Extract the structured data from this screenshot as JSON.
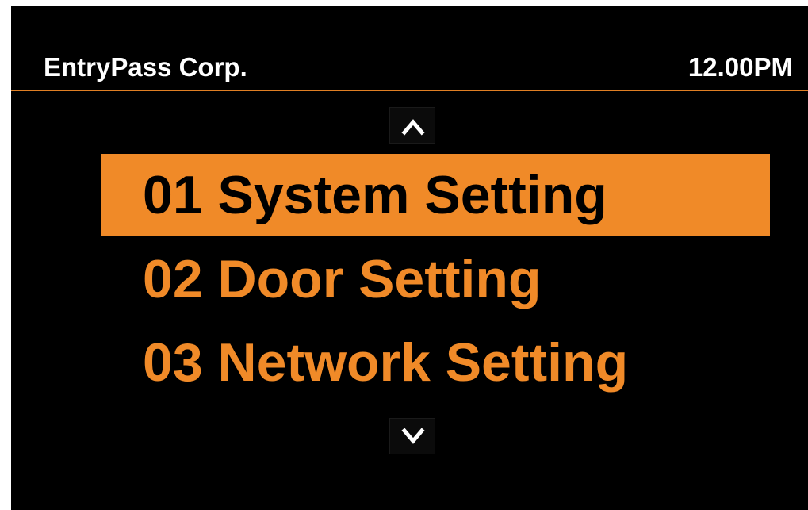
{
  "header": {
    "company": "EntryPass Corp.",
    "time": "12.00PM"
  },
  "navigation": {
    "up_icon": "chevron-up-icon",
    "down_icon": "chevron-down-icon"
  },
  "menu": {
    "items": [
      {
        "label": "01 System Setting",
        "selected": true
      },
      {
        "label": "02 Door Setting",
        "selected": false
      },
      {
        "label": "03 Network Setting",
        "selected": false
      }
    ]
  },
  "colors": {
    "accent": "#f08a28",
    "background": "#000000",
    "header_text": "#ffffff"
  }
}
